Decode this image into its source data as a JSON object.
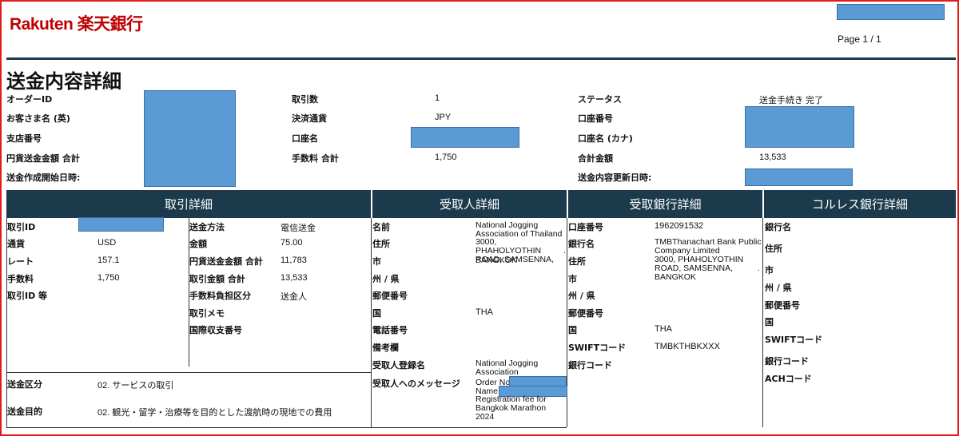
{
  "header": {
    "logo": "Rakuten 楽天銀行",
    "page": "Page 1 / 1",
    "title": "送金内容詳細"
  },
  "summary": {
    "order_id_label": "オーダーID",
    "customer_name_label": "お客さま名 (英)",
    "branch_label": "支店番号",
    "jpy_total_label": "円貨送金金額 合計",
    "created_label": "送金作成開始日時:",
    "txn_count_label": "取引数",
    "txn_count": "1",
    "currency_label": "決済通貨",
    "currency": "JPY",
    "account_name_label": "口座名",
    "fee_total_label": "手数料 合計",
    "fee_total": "1,750",
    "status_label": "ステータス",
    "status": "送金手続き 完了",
    "account_no_label": "口座番号",
    "account_kana_label": "口座名 (カナ)",
    "grand_total_label": "合計金額",
    "grand_total": "13,533",
    "updated_label": "送金内容更新日時:"
  },
  "sections": {
    "transaction": "取引詳細",
    "recipient": "受取人詳細",
    "recipient_bank": "受取銀行詳細",
    "correspondent": "コルレス銀行詳細"
  },
  "transaction": {
    "txn_id_label": "取引ID",
    "currency_label": "通貨",
    "currency": "USD",
    "rate_label": "レート",
    "rate": "157.1",
    "fee_label": "手数料",
    "fee": "1,750",
    "txn_id_etc_label": "取引ID 等",
    "method_label": "送金方法",
    "method": "電信送金",
    "amount_label": "金額",
    "amount": "75.00",
    "jpy_total_label": "円貨送金金額 合計",
    "jpy_total": "11,783",
    "txn_total_label": "取引金額 合計",
    "txn_total": "13,533",
    "fee_bearer_label": "手数料負担区分",
    "fee_bearer": "送金人",
    "memo_label": "取引メモ",
    "intl_code_label": "国際収支番号",
    "category_label": "送金区分",
    "category": "02. サービスの取引",
    "purpose_label": "送金目的",
    "purpose": "02. 観光・留学・治療等を目的とした渡航時の現地での費用"
  },
  "recipient": {
    "name_label": "名前",
    "name": "National Jogging Association of Thailand",
    "address_label": "住所",
    "address": "3000, PHAHOLYOTHIN ROAD, SAMSENNA,",
    "city_label": "市",
    "city": "BANGKOK",
    "state_label": "州 / 県",
    "postal_label": "郵便番号",
    "country_label": "国",
    "country": "THA",
    "phone_label": "電話番号",
    "notes_label": "備考欄",
    "reg_name_label": "受取人登録名",
    "reg_name": "National Jogging Association",
    "message_label": "受取人へのメッセージ",
    "msg_line1": "Order No",
    "msg_line2": "Name",
    "msg_line3": "Registration fee for Bangkok Marathon 2024",
    "dot": "."
  },
  "recipient_bank": {
    "account_label": "口座番号",
    "account": "1962091532",
    "bank_label": "銀行名",
    "bank": "TMBThanachart Bank Public Company Limited",
    "address_label": "住所",
    "address": "3000, PHAHOLYOTHIN ROAD, SAMSENNA, BANGKOK",
    "city_label": "市",
    "state_label": "州 / 県",
    "postal_label": "郵便番号",
    "country_label": "国",
    "country": "THA",
    "swift_label": "SWIFTコード",
    "swift": "TMBKTHBKXXX",
    "bank_code_label": "銀行コード",
    "dot": "."
  },
  "correspondent": {
    "bank_label": "銀行名",
    "address_label": "住所",
    "city_label": "市",
    "state_label": "州 / 県",
    "postal_label": "郵便番号",
    "country_label": "国",
    "swift_label": "SWIFTコード",
    "bank_code_label": "銀行コード",
    "ach_label": "ACHコード"
  }
}
